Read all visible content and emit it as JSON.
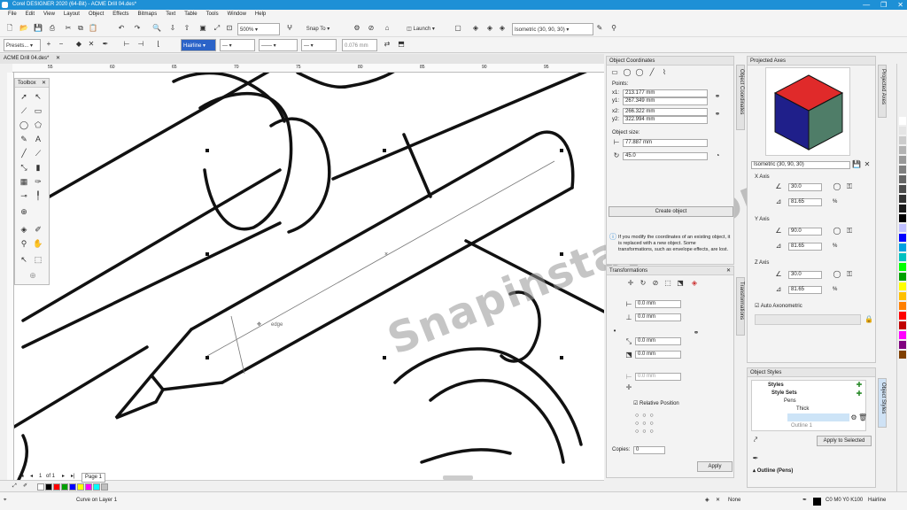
{
  "window": {
    "title": "Corel DESIGNER 2020 (64-Bit) - ACME Drill 04.des*",
    "controls": [
      "—",
      "❐",
      "✕"
    ]
  },
  "menu": [
    "File",
    "Edit",
    "View",
    "Layout",
    "Object",
    "Effects",
    "Bitmaps",
    "Text",
    "Table",
    "Tools",
    "Window",
    "Help"
  ],
  "toolbar": {
    "zoom": "500%",
    "snap_to": "Snap To",
    "launch": "Launch",
    "projection": "Isometric (30, 90, 30)"
  },
  "propbar": {
    "preset": "Presets...",
    "line_style": "Hairline",
    "width": "0.076 mm"
  },
  "doc_tab": "ACME Drill 04.des*",
  "ruler_ticks": [
    "0",
    "55",
    "60",
    "65",
    "70",
    "75",
    "80",
    "85",
    "90",
    "95",
    "100"
  ],
  "toolbox": {
    "title": "Toolbox"
  },
  "canvas": {
    "edge_label": "edge"
  },
  "page_nav": {
    "current": "1",
    "of": "of 1",
    "page": "Page 1"
  },
  "object_coords": {
    "title": "Object Coordinates",
    "points_label": "Points:",
    "x1_label": "x1:",
    "x1": "213.177 mm",
    "y1_label": "y1:",
    "y1": "267.349 mm",
    "x2_label": "x2:",
    "x2": "266.322 mm",
    "y2_label": "y2:",
    "y2": "322.994 mm",
    "size_label": "Object size:",
    "length": "77.887 mm",
    "angle": "45.0",
    "create_button": "Create object",
    "info": "If you modify the coordinates of an existing object, it is replaced with a new object. Some transformations, such as envelope effects, are lost.",
    "vtab": "Object Coordinates"
  },
  "transformations": {
    "title": "Transformations",
    "x": "0.0 mm",
    "y": "0.0 mm",
    "w": "0.0 mm",
    "h": "0.0 mm",
    "relative": "Relative Position",
    "copies_label": "Copies:",
    "copies": "0",
    "apply": "Apply",
    "vtab": "Transformations"
  },
  "projected_axes": {
    "title": "Projected Axes",
    "preset": "Isometric (30, 90, 30)",
    "x_axis": "X Axis",
    "x_angle": "30.0",
    "x_scale": "81.65",
    "y_axis": "Y Axis",
    "y_angle": "90.0",
    "y_scale": "81.65",
    "z_axis": "Z Axis",
    "z_angle": "30.0",
    "z_scale": "81.65",
    "pct": "%",
    "auto": "Auto Axonometric",
    "vtab": "Projected Axes",
    "cube_colors": {
      "top": "#e02a2a",
      "left": "#1f1f8a",
      "right": "#4f7d68"
    }
  },
  "object_styles": {
    "title": "Object Styles",
    "tree": [
      "Styles",
      "Style Sets",
      "Pens",
      "Thick",
      "Outline 1"
    ],
    "apply_selected": "Apply to Selected",
    "outline_section": "Outline (Pens)",
    "vtab": "Object Styles"
  },
  "status": {
    "message": "Curve on Layer 1",
    "fill": "None",
    "color_model": "C0 M0 Y0 K100",
    "outline": "Hairline"
  },
  "palette_colors": [
    "#ffffff",
    "#e5e5e5",
    "#cccccc",
    "#b3b3b3",
    "#999999",
    "#808080",
    "#666666",
    "#4d4d4d",
    "#333333",
    "#1a1a1a",
    "#000000",
    "#c0c0ff",
    "#0000ff",
    "#00a0e0",
    "#00c0c0",
    "#00ff00",
    "#00a000",
    "#ffff00",
    "#ffc000",
    "#ff8000",
    "#ff0000",
    "#c00000",
    "#ff00ff",
    "#800080",
    "#804000"
  ],
  "swatches": [
    "#ffffff",
    "#000000",
    "#ff0000",
    "#00a000",
    "#0000ff",
    "#ffff00",
    "#ff00ff",
    "#00ffff",
    "#c0c0c0"
  ],
  "watermark": "Snapinstapc.com"
}
